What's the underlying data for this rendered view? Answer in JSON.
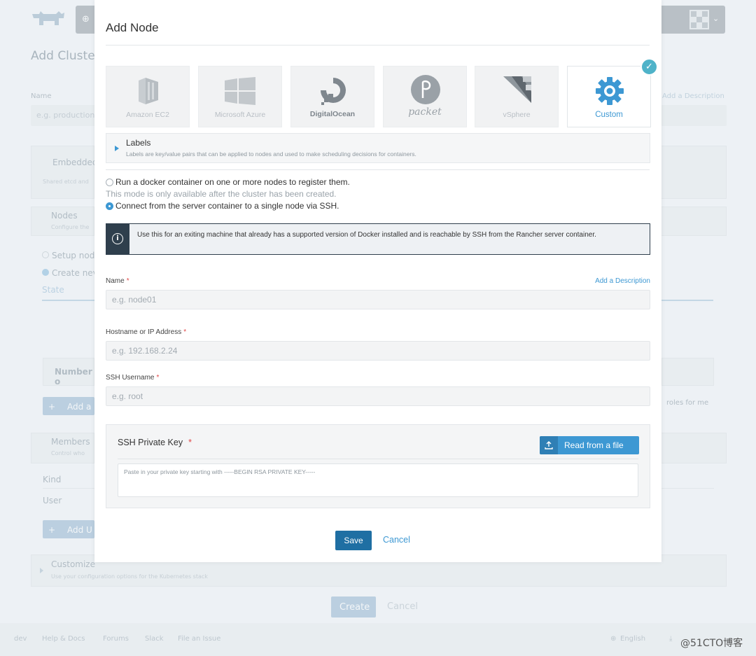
{
  "background": {
    "title": "Add Cluster",
    "name_label": "Name",
    "name_placeholder": "e.g. production",
    "add_description": "Add a Description",
    "embedded_title": "Embedded",
    "embedded_sub": "Shared etcd and",
    "nodes_title": "Nodes",
    "nodes_sub": "Configure the",
    "setup_option": "Setup nod",
    "create_option": "Create nev",
    "state_label": "State",
    "number_header": "Number o",
    "add_button": "Add a",
    "roles_text": "roles for me",
    "members_title": "Members",
    "members_sub": "Control who",
    "kind_label": "Kind",
    "user_label": "User",
    "add_user_button": "Add U",
    "customize_title": "Customize",
    "customize_sub": "Use your configuration options for the Kubernetes stack",
    "create_button": "Create",
    "cancel_button": "Cancel"
  },
  "footer": {
    "links": [
      "dev",
      "Help & Docs",
      "Forums",
      "Slack",
      "File an Issue"
    ],
    "language": "English",
    "download": "Download"
  },
  "modal": {
    "title": "Add Node",
    "drivers": [
      {
        "label": "Amazon EC2",
        "icon": "amazon-ec2-icon"
      },
      {
        "label": "Microsoft Azure",
        "icon": "microsoft-azure-icon"
      },
      {
        "label": "DigitalOcean",
        "icon": "digitalocean-icon"
      },
      {
        "label": "packet",
        "icon": "packet-icon"
      },
      {
        "label": "vSphere",
        "icon": "vsphere-icon"
      },
      {
        "label": "Custom",
        "icon": "gear-icon"
      }
    ],
    "selected_driver": "Custom",
    "labels": {
      "title": "Labels",
      "description": "Labels are key/value pairs that can be applied to nodes and used to make scheduling decisions for containers."
    },
    "options": {
      "option1": "Run a docker container on one or more nodes to register them.",
      "option1_note": "This mode is only available after the cluster has been created.",
      "option2": "Connect from the server container to a single node via SSH."
    },
    "info": "Use this for an exiting machine that already has a supported version of Docker installed and is reachable by SSH from the Rancher server container.",
    "fields": {
      "name_label": "Name",
      "name_placeholder": "e.g. node01",
      "add_description": "Add a Description",
      "hostname_label": "Hostname or IP Address",
      "hostname_placeholder": "e.g. 192.168.2.24",
      "ssh_user_label": "SSH Username",
      "ssh_user_placeholder": "e.g. root",
      "required_mark": "*"
    },
    "ssh_key": {
      "title": "SSH Private Key",
      "read_button": "Read from a file",
      "placeholder": "Paste in your private key starting with -----BEGIN RSA PRIVATE KEY-----"
    },
    "save_button": "Save",
    "cancel_link": "Cancel"
  },
  "watermark": "@51CTO博客",
  "colors": {
    "accent": "#3d98d3",
    "save": "#1f6fa3",
    "info_dark": "#2f3f4d",
    "check": "#4fb3c9"
  }
}
